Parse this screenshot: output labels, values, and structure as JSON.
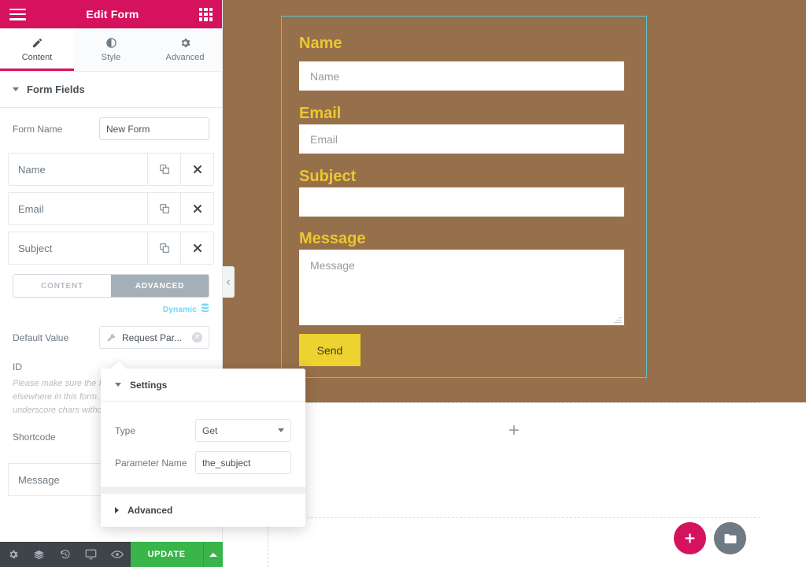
{
  "panel": {
    "header": {
      "title": "Edit Form",
      "menu_icon": "hamburger-icon",
      "widgets_icon": "grid-icon"
    },
    "tabs": [
      {
        "label": "Content",
        "icon": "pencil-icon",
        "active": true
      },
      {
        "label": "Style",
        "icon": "contrast-icon",
        "active": false
      },
      {
        "label": "Advanced",
        "icon": "gear-icon",
        "active": false
      }
    ],
    "section": {
      "title": "Form Fields",
      "expanded": true
    },
    "form_name": {
      "label": "Form Name",
      "value": "New Form"
    },
    "fields": [
      {
        "title": "Name",
        "duplicate_icon": "copy-icon",
        "remove_icon": "close-icon"
      },
      {
        "title": "Email",
        "duplicate_icon": "copy-icon",
        "remove_icon": "close-icon"
      },
      {
        "title": "Subject",
        "duplicate_icon": "copy-icon",
        "remove_icon": "close-icon"
      },
      {
        "title": "Message",
        "duplicate_icon": "copy-icon",
        "remove_icon": "close-icon"
      }
    ],
    "segmented": {
      "content": "CONTENT",
      "advanced": "ADVANCED",
      "active": "ADVANCED"
    },
    "dynamic": {
      "label": "Dynamic",
      "icon": "database-icon"
    },
    "default_value": {
      "label": "Default Value",
      "tag_text": "Request Par...",
      "tag_icon": "wrench-icon",
      "remove_icon": "circle-x-icon"
    },
    "id": {
      "label": "ID"
    },
    "help_note": "Please make sure the ID is unique and not used elsewhere in this form. This field allows A-z 0-9 & underscore chars without spaces.",
    "shortcode": {
      "label": "Shortcode"
    },
    "footer": {
      "icons": [
        "gear-icon",
        "layers-icon",
        "history-icon",
        "responsive-icon",
        "eye-icon"
      ],
      "update_label": "UPDATE",
      "update_caret_icon": "caret-up-icon"
    },
    "collapse_handle_icon": "chevron-left-icon"
  },
  "popover": {
    "title": "Settings",
    "type": {
      "label": "Type",
      "value": "Get"
    },
    "parameter_name": {
      "label": "Parameter Name",
      "value": "the_subject"
    },
    "advanced": {
      "label": "Advanced",
      "expanded": false
    }
  },
  "canvas": {
    "form": {
      "selected": true,
      "fields": [
        {
          "label": "Name",
          "placeholder": "Name",
          "type": "text"
        },
        {
          "label": "Email",
          "placeholder": "Email",
          "type": "email"
        },
        {
          "label": "Subject",
          "placeholder": "",
          "type": "text"
        },
        {
          "label": "Message",
          "placeholder": "Message",
          "type": "textarea"
        }
      ],
      "submit_label": "Send"
    },
    "empty_section": {
      "add_icon": "plus-icon"
    },
    "fab_add": {
      "icon": "plus-icon"
    },
    "fab_library": {
      "icon": "folder-icon"
    }
  },
  "colors": {
    "brand_pink": "#d6115e",
    "update_green": "#39b54a",
    "label_yellow": "#edc731",
    "button_yellow": "#edd230",
    "selection_teal": "#5ec3cf",
    "dynamic_blue": "#71d7f7",
    "footer_dark": "#3f444b"
  }
}
